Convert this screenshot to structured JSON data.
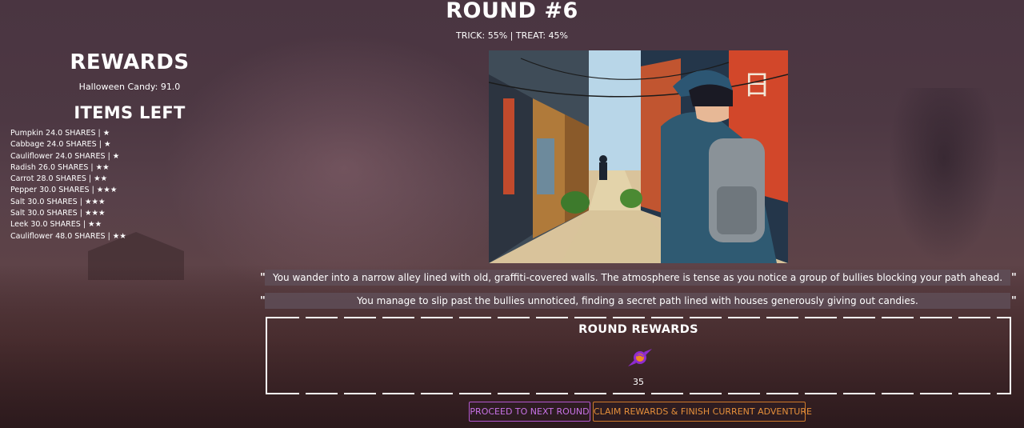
{
  "round": {
    "title": "ROUND #6",
    "odds": "TRICK: 55% | TREAT: 45%"
  },
  "sidebar": {
    "rewards_title": "REWARDS",
    "candy_line": "Halloween Candy: 91.0",
    "items_title": "ITEMS LEFT",
    "items": [
      "Pumpkin 24.0 SHARES | ★",
      "Cabbage 24.0 SHARES | ★",
      "Cauliflower 24.0 SHARES | ★",
      "Radish 26.0 SHARES | ★★",
      "Carrot 28.0 SHARES | ★★",
      "Pepper 30.0 SHARES | ★★★",
      "Salt 30.0 SHARES | ★★★",
      "Salt 30.0 SHARES | ★★★",
      "Leek 30.0 SHARES | ★★",
      "Cauliflower 48.0 SHARES | ★★"
    ]
  },
  "story": {
    "open_quote": "\"",
    "close_quote": "\"",
    "line1": "You wander into a narrow alley lined with old, graffiti-covered walls. The atmosphere is tense as you notice a group of bullies blocking your path ahead.",
    "line2": "You manage to slip past the bullies unnoticed, finding a secret path lined with houses generously giving out candies."
  },
  "round_rewards": {
    "title": "ROUND REWARDS",
    "icon": "candy-icon",
    "count": "35"
  },
  "buttons": {
    "next": "PROCEED TO NEXT ROUND",
    "claim": "CLAIM REWARDS & FINISH CURRENT ADVENTURE"
  },
  "colors": {
    "next_button": "#c872e6",
    "claim_button": "#e58f3a",
    "candy_purple": "#8e2bd0",
    "candy_orange": "#f08a1e"
  }
}
